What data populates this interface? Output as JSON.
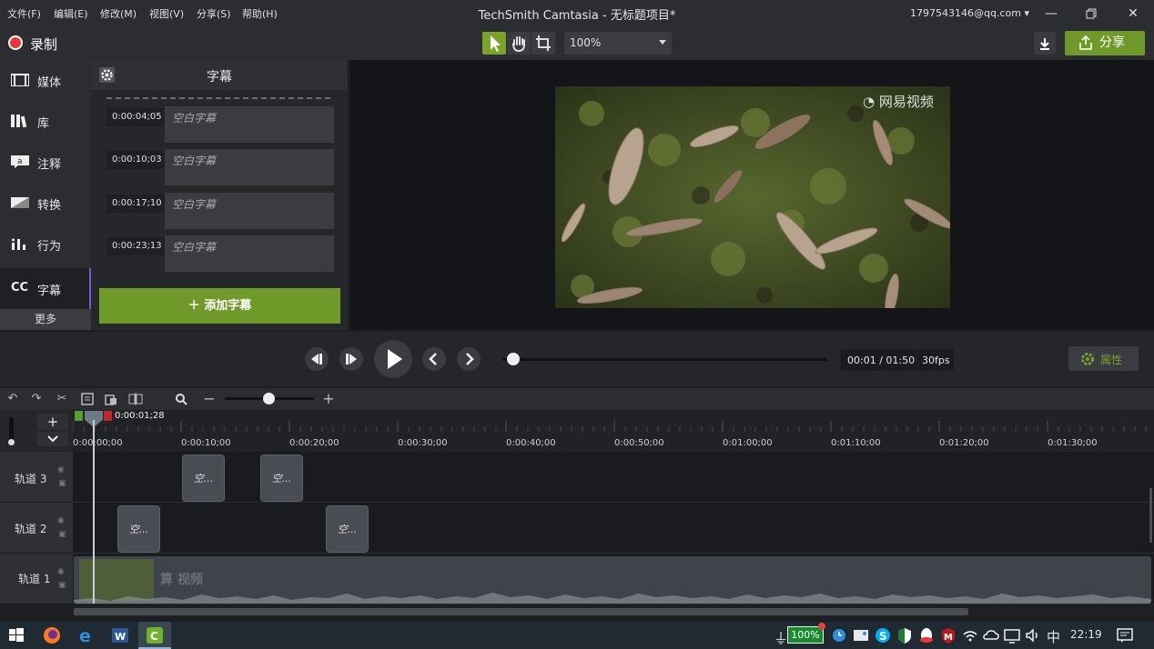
{
  "menu": [
    "文件(F)",
    "编辑(E)",
    "修改(M)",
    "视图(V)",
    "分享(S)",
    "帮助(H)"
  ],
  "window_title": "TechSmith Camtasia - 无标题项目*",
  "account": "1797543146@qq.com",
  "toolbar": {
    "record_label": "录制",
    "zoom_value": "100%",
    "share_label": "分享"
  },
  "sidebar": {
    "items": [
      {
        "label": "媒体",
        "icon": "film-icon"
      },
      {
        "label": "库",
        "icon": "library-icon"
      },
      {
        "label": "注释",
        "icon": "annotation-icon"
      },
      {
        "label": "转换",
        "icon": "transition-icon"
      },
      {
        "label": "行为",
        "icon": "behavior-icon"
      },
      {
        "label": "字幕",
        "icon": "cc-icon",
        "badge": "CC"
      }
    ],
    "more_label": "更多"
  },
  "captions_panel": {
    "title": "字幕",
    "captions": [
      {
        "time": "0:00:04;05",
        "text": "空白字幕"
      },
      {
        "time": "0:00:10;03",
        "text": "空白字幕"
      },
      {
        "time": "0:00:17;10",
        "text": "空白字幕"
      },
      {
        "time": "0:00:23;13",
        "text": "空白字幕"
      }
    ],
    "add_label": "添加字幕"
  },
  "preview": {
    "watermark": "网易视频"
  },
  "playback": {
    "timecode": "00:01 / 01:50",
    "fps": "30fps",
    "properties_label": "属性",
    "progress": 0.02
  },
  "timeline": {
    "playhead_time": "0:00:01;28",
    "zoom_level": 0.42,
    "ticks": [
      "0:00:00;00",
      "0:00:10;00",
      "0:00:20;00",
      "0:00:30;00",
      "0:00:40;00",
      "0:00:50;00",
      "0:01:00;00",
      "0:01:10;00",
      "0:01:20;00",
      "0:01:30;00"
    ],
    "tracks": [
      {
        "name": "轨道 3",
        "clips": [
          "空...",
          "空..."
        ]
      },
      {
        "name": "轨道 2",
        "clips": [
          "空...",
          "空..."
        ]
      },
      {
        "name": "轨道 1",
        "clips": [
          "算 视频"
        ]
      }
    ]
  },
  "taskbar": {
    "battery": "100%",
    "ime": "中",
    "clock": "22:19"
  },
  "colors": {
    "accent_green": "#6f9a2a",
    "record_red": "#e33333",
    "caption_purple": "#6f5bd6"
  }
}
